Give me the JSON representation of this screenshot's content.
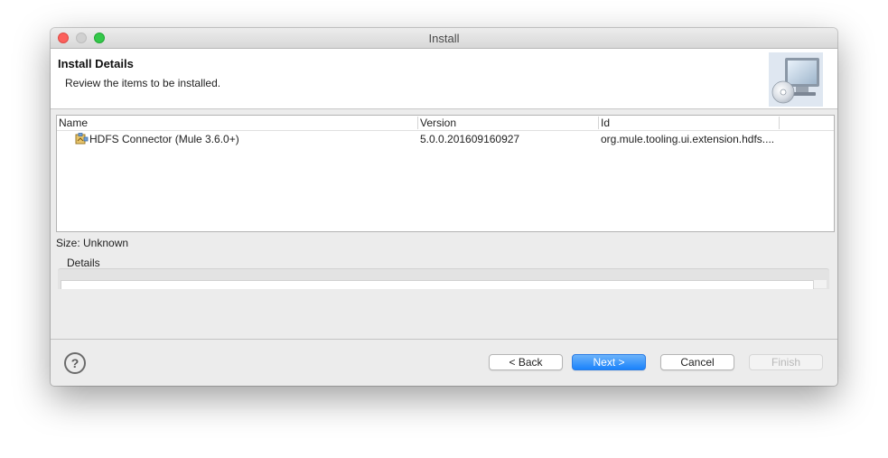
{
  "window": {
    "title": "Install"
  },
  "header": {
    "title": "Install Details",
    "subtitle": "Review the items to be installed.",
    "banner_icon": "install-wizard-computer-cd-icon"
  },
  "table": {
    "columns": [
      "Name",
      "Version",
      "Id"
    ],
    "rows": [
      {
        "name": "HDFS Connector (Mule 3.6.0+)",
        "version": "5.0.0.201609160927",
        "id": "org.mule.tooling.ui.extension.hdfs....",
        "icon": "feature-plugin-icon"
      }
    ]
  },
  "size_label": "Size: Unknown",
  "details_label": "Details",
  "footer": {
    "help_icon": "?",
    "back_label": "< Back",
    "next_label": "Next >",
    "cancel_label": "Cancel",
    "finish_label": "Finish"
  },
  "colors": {
    "primary_button": "#1a82fb",
    "close": "#fc605c",
    "zoom": "#34c84a"
  }
}
